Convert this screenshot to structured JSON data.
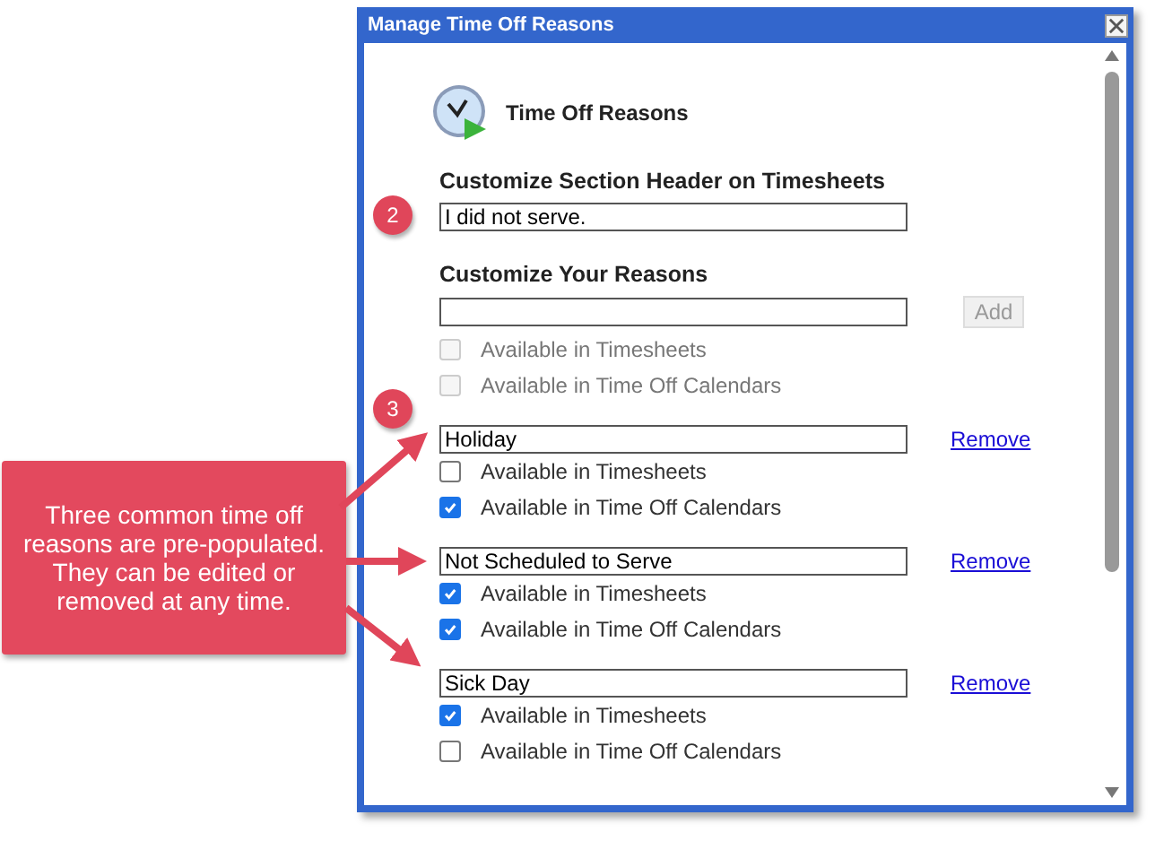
{
  "window": {
    "title": "Manage Time Off Reasons"
  },
  "header": {
    "title": "Time Off Reasons"
  },
  "section_header": {
    "label": "Customize Section Header on Timesheets",
    "value": "I did not serve."
  },
  "new_reason": {
    "label": "Customize Your Reasons",
    "add_button": {
      "label": "Add",
      "disabled": true
    },
    "options": [
      {
        "label": "Available in Timesheets",
        "checked": false,
        "disabled": true
      },
      {
        "label": "Available in Time Off Calendars",
        "checked": false,
        "disabled": true
      }
    ]
  },
  "reasons": [
    {
      "name": "Holiday",
      "remove_label": "Remove",
      "options": [
        {
          "label": "Available in Timesheets",
          "checked": false,
          "disabled": false
        },
        {
          "label": "Available in Time Off Calendars",
          "checked": true,
          "disabled": false
        }
      ]
    },
    {
      "name": "Not Scheduled to Serve",
      "remove_label": "Remove",
      "options": [
        {
          "label": "Available in Timesheets",
          "checked": true,
          "disabled": false
        },
        {
          "label": "Available in Time Off Calendars",
          "checked": true,
          "disabled": false
        }
      ]
    },
    {
      "name": "Sick Day",
      "remove_label": "Remove",
      "options": [
        {
          "label": "Available in Timesheets",
          "checked": true,
          "disabled": false
        },
        {
          "label": "Available in Time Off Calendars",
          "checked": false,
          "disabled": false
        }
      ]
    }
  ],
  "annotations": {
    "badges": [
      {
        "number": "2"
      },
      {
        "number": "3"
      }
    ],
    "callout": {
      "text": "Three common time off reasons are pre-populated. They can be edited or removed at any time."
    }
  }
}
